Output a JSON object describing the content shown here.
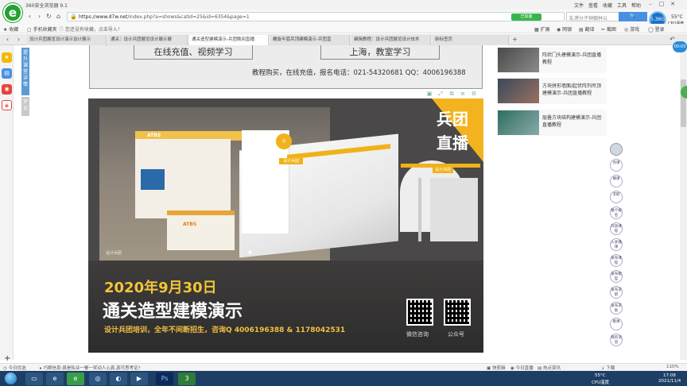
{
  "app": {
    "title": "360安全浏览器 9.1"
  },
  "menu": [
    "文件",
    "查看",
    "收藏",
    "工具",
    "帮助"
  ],
  "window_controls": [
    "minimize",
    "maximize",
    "close"
  ],
  "address": {
    "url_domain": "https://www.d7w.net",
    "url_path": "/index.php?a=shows&catid=25&id=6354&page=1",
    "accelerate_label": "已加速",
    "search_placeholder": "乱港分子钟翰林以"
  },
  "weather": {
    "badge": "5.36G",
    "temp": "55°C",
    "cpu": "CPU温度"
  },
  "toolbar_right": [
    "扩展",
    "网银",
    "翻译",
    "截图",
    "游戏",
    "登录"
  ],
  "favbar": {
    "fav_label": "收藏",
    "mobile_fav": "手机收藏夹",
    "hint": "您还没有收藏，点击导入！"
  },
  "tabs": [
    {
      "label": "设计兵团展览设计演示设计展示",
      "active": false
    },
    {
      "label": "通关：设计兵团展览设计展示展",
      "active": false
    },
    {
      "label": "通关造型建模演示-兵团晚间直播",
      "active": true
    },
    {
      "label": "螺旋半弧吊顶建模演示-兵团直",
      "active": false
    },
    {
      "label": "编辑教程：设计兵团展览设计技术",
      "active": false
    },
    {
      "label": "新标签页",
      "active": false
    }
  ],
  "left_sidebar": {
    "blue_label": "提升课堂详情",
    "gray_label": "评论"
  },
  "banner": {
    "left_box": "在线充值、视频学习",
    "right_box": "上海，教室学习",
    "contact": "教程购买，在线充值，报名电话：021-54320681   QQ：4006196388"
  },
  "video": {
    "corner_line1": "兵团",
    "corner_line2": "直播",
    "booth_logo": "ATBS",
    "counter_logo": "ATBS",
    "model_sign": "设计兵团",
    "model_sign2": "设计兵团",
    "photo_watermark": "设计兵团",
    "date": "2020年9月30日",
    "course_title": "通关造型建模演示",
    "promo": "设计兵团培训，全年不间断招生，咨询Q  4006196388 & 1178042531",
    "qr1_label": "微信咨询",
    "qr2_label": "公众号"
  },
  "related": [
    {
      "title": "阵状门头建模演示-兵团直播教程"
    },
    {
      "title": "方块拼形墙面/起伏阵列吊顶建模演示-兵团直播教程"
    },
    {
      "title": "层叠方块结构建模演示-兵团直播教程"
    }
  ],
  "right_panel": {
    "buttons": [
      "亮课",
      "摘课",
      "求职",
      "推介报名",
      "开放课程",
      "入驻播课",
      "发布课程",
      "发布模型",
      "发布求职",
      "发布求助",
      "看课",
      "我的消息"
    ]
  },
  "float_badge": "00:03",
  "statusbar": {
    "left1": "今日优选",
    "left2": "巧眼信息:真是私业一餐一奖动人心真,真可思考证?",
    "right": [
      "快剪辑",
      "今日直播",
      "热点资讯",
      "下载",
      "110%"
    ]
  },
  "taskbar": {
    "temp": "55°C",
    "cpu": "CPU温度",
    "time": "17:08",
    "date": "2021/11/4"
  }
}
